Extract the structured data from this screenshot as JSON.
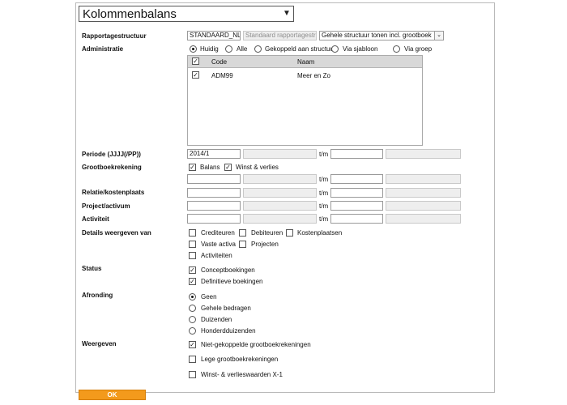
{
  "report": {
    "selected": "Kolommenbalans"
  },
  "rapportagestructuur": {
    "label": "Rapportagestructuur",
    "code": "STANDAARD_NL",
    "name_placeholder": "Standaard rapportagestru",
    "option": "Gehele structuur tonen incl. grootboek"
  },
  "administratie": {
    "label": "Administratie",
    "options": [
      "Huidig",
      "Alle",
      "Gekoppeld aan structuur",
      "Via sjabloon",
      "Via groep"
    ],
    "selected": "Huidig",
    "columns": {
      "code": "Code",
      "naam": "Naam"
    },
    "rows": [
      {
        "code": "ADM99",
        "naam": "Meer en Zo",
        "checked": true
      }
    ]
  },
  "periode": {
    "label": "Periode (JJJJ(/PP))",
    "from": "2014/1",
    "tm": "t/m"
  },
  "grootboek": {
    "label": "Grootboekrekening",
    "balans": "Balans",
    "winst": "Winst & verlies",
    "tm": "t/m"
  },
  "relatie": {
    "label": "Relatie/kostenplaats",
    "tm": "t/m"
  },
  "project": {
    "label": "Project/activum",
    "tm": "t/m"
  },
  "activiteit": {
    "label": "Activiteit",
    "tm": "t/m"
  },
  "details": {
    "label": "Details weergeven van",
    "items": [
      "Crediteuren",
      "Debiteuren",
      "Kostenplaatsen",
      "Vaste activa",
      "Projecten",
      "Activiteiten"
    ]
  },
  "status": {
    "label": "Status",
    "items": [
      "Conceptboekingen",
      "Definitieve boekingen"
    ]
  },
  "afronding": {
    "label": "Afronding",
    "items": [
      "Geen",
      "Gehele bedragen",
      "Duizenden",
      "Honderdduizenden"
    ],
    "selected": "Geen"
  },
  "weergeven": {
    "label": "Weergeven",
    "items": [
      "Niet-gekoppelde grootboekrekeningen",
      "Lege grootboekrekeningen",
      "Winst- & verlieswaarden X-1"
    ]
  },
  "ok": {
    "label": "OK"
  }
}
